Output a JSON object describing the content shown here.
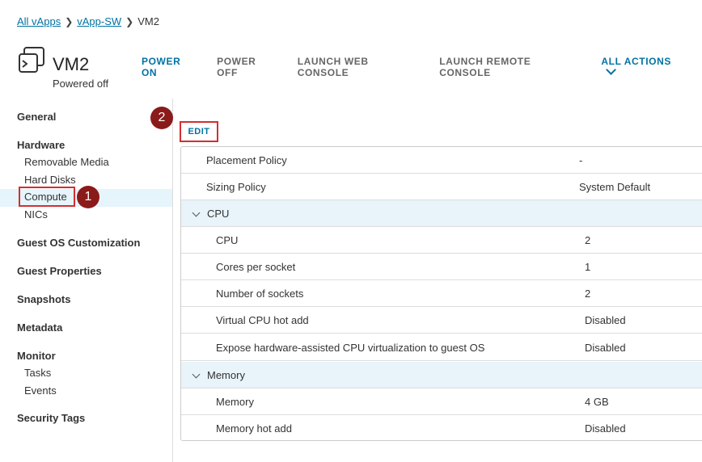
{
  "breadcrumb": {
    "items": [
      "All vApps",
      "vApp-SW",
      "VM2"
    ]
  },
  "vm": {
    "name": "VM2",
    "status": "Powered off"
  },
  "actions": [
    "POWER ON",
    "POWER OFF",
    "LAUNCH WEB CONSOLE",
    "LAUNCH REMOTE CONSOLE",
    "ALL ACTIONS"
  ],
  "nav": {
    "general": "General",
    "hardware": "Hardware",
    "removable_media": "Removable Media",
    "hard_disks": "Hard Disks",
    "compute": "Compute",
    "nics": "NICs",
    "guest_os": "Guest OS Customization",
    "guest_props": "Guest Properties",
    "snapshots": "Snapshots",
    "metadata": "Metadata",
    "monitor": "Monitor",
    "tasks": "Tasks",
    "events": "Events",
    "security_tags": "Security Tags"
  },
  "callouts": [
    "1",
    "2"
  ],
  "edit_label": "EDIT",
  "table": {
    "placement_label": "Placement Policy",
    "placement_value": "-",
    "sizing_label": "Sizing Policy",
    "sizing_value": "System Default",
    "cpu_group": "CPU",
    "cpu_label": "CPU",
    "cpu_value": "2",
    "cores_label": "Cores per socket",
    "cores_value": "1",
    "sockets_label": "Number of sockets",
    "sockets_value": "2",
    "hotadd_label": "Virtual CPU hot add",
    "hotadd_value": "Disabled",
    "expose_label": "Expose hardware-assisted CPU virtualization to guest OS",
    "expose_value": "Disabled",
    "memory_group": "Memory",
    "memory_label": "Memory",
    "memory_value": "4 GB",
    "mem_hotadd_label": "Memory hot add",
    "mem_hotadd_value": "Disabled"
  },
  "colors": {
    "accent": "#0072a3",
    "callout": "#8b1a1a",
    "highlight_border": "#d32f2f",
    "selected_bg": "#e6f4fb"
  }
}
